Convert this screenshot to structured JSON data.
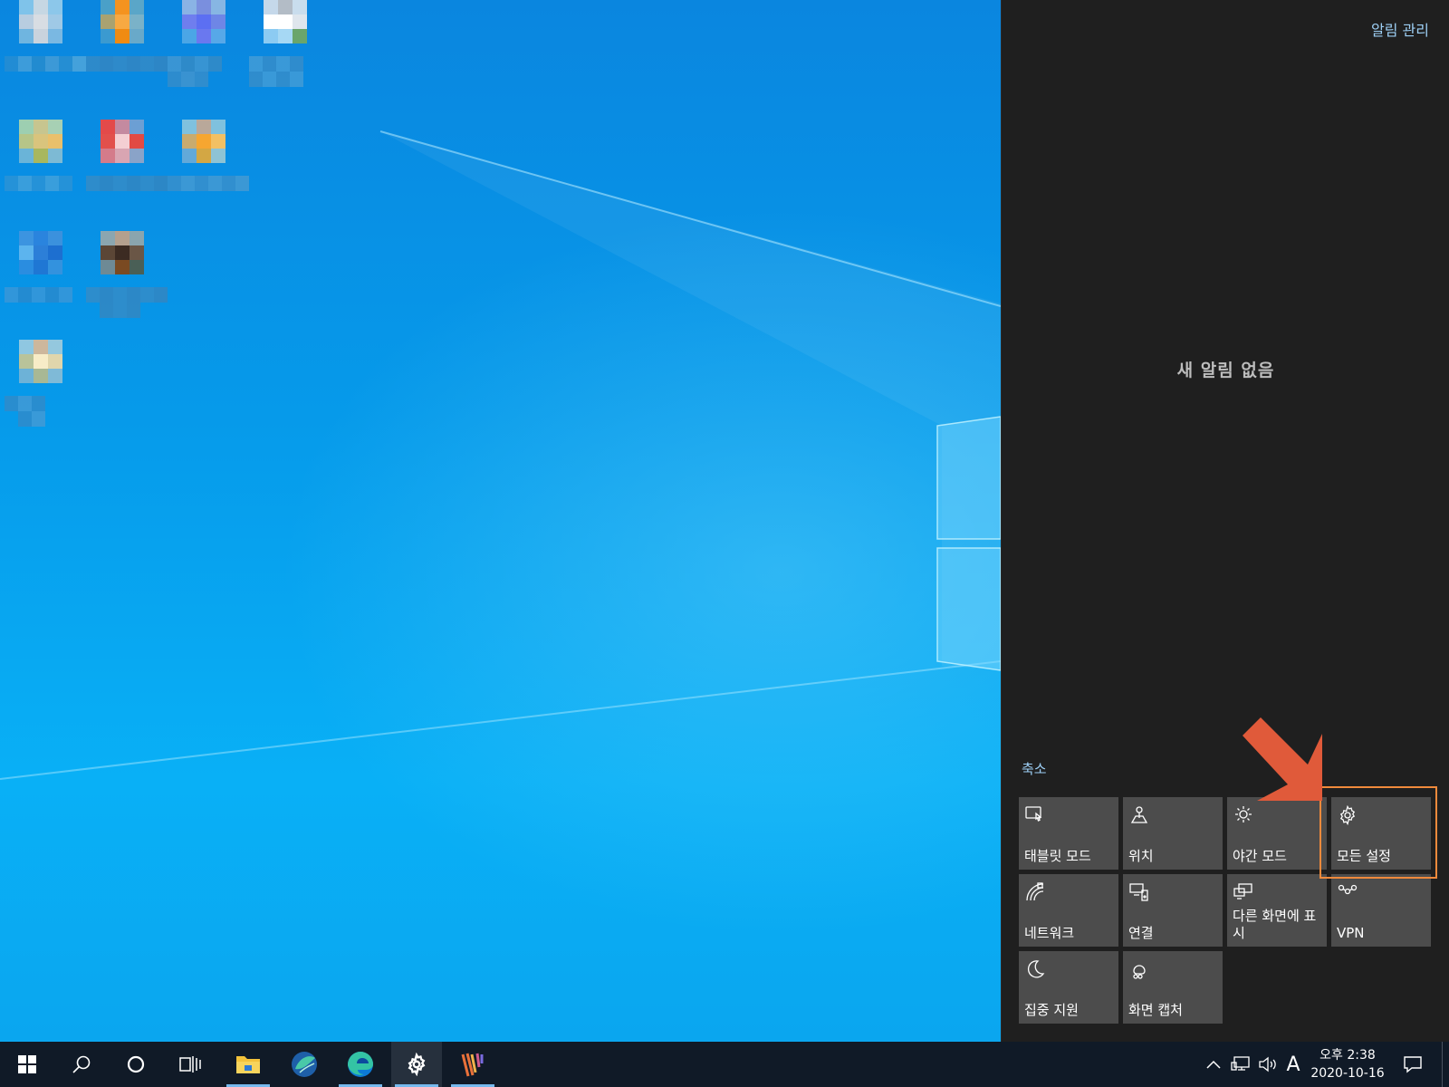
{
  "action_center": {
    "manage_notifications": "알림 관리",
    "no_notifications": "새 알림 없음",
    "collapse": "축소",
    "tiles": [
      {
        "label": "태블릿 모드",
        "icon": "tablet-mode-icon"
      },
      {
        "label": "위치",
        "icon": "location-icon"
      },
      {
        "label": "야간 모드",
        "icon": "night-light-icon"
      },
      {
        "label": "모든 설정",
        "icon": "gear-icon"
      },
      {
        "label": "네트워크",
        "icon": "network-icon"
      },
      {
        "label": "연결",
        "icon": "connect-icon"
      },
      {
        "label": "다른 화면에 표시",
        "icon": "project-icon"
      },
      {
        "label": "VPN",
        "icon": "vpn-icon"
      },
      {
        "label": "집중 지원",
        "icon": "focus-assist-icon"
      },
      {
        "label": "화면 캡처",
        "icon": "screen-snip-icon"
      }
    ],
    "highlighted_tile": "모든 설정",
    "annotation_color": "#e05a3a",
    "highlight_color": "#f08a3c"
  },
  "taskbar": {
    "pinned": [
      {
        "name": "start-button",
        "icon": "windows-logo-icon"
      },
      {
        "name": "search-button",
        "icon": "search-icon"
      },
      {
        "name": "cortana-button",
        "icon": "cortana-circle-icon"
      },
      {
        "name": "task-view-button",
        "icon": "task-view-icon"
      },
      {
        "name": "file-explorer-button",
        "icon": "folder-icon"
      },
      {
        "name": "app-button",
        "icon": "leaf-app-icon"
      },
      {
        "name": "edge-button",
        "icon": "edge-icon"
      },
      {
        "name": "settings-button",
        "icon": "gear-icon"
      },
      {
        "name": "app-button-2",
        "icon": "stripes-app-icon"
      }
    ],
    "tray": {
      "input_indicator": "A",
      "clock_time": "오후 2:38",
      "clock_date": "2020-10-16"
    }
  },
  "colors": {
    "accent": "#0078d7",
    "panel_bg": "#1f1f1f",
    "tile_bg": "#4c4c4c",
    "link": "#9dcff5",
    "taskbar_bg": "#101a27"
  }
}
